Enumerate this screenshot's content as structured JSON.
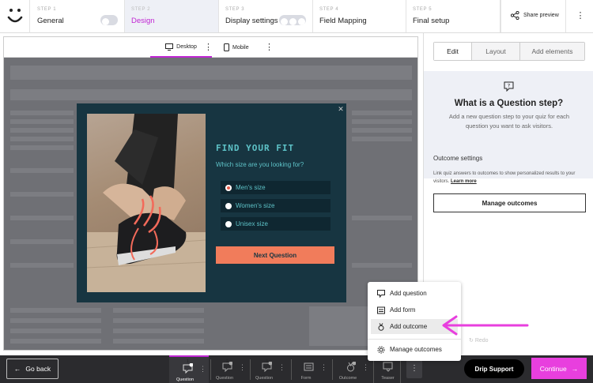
{
  "topbar": {
    "steps": [
      {
        "step_label": "STEP 1",
        "name": "General"
      },
      {
        "step_label": "STEP 2",
        "name": "Design"
      },
      {
        "step_label": "STEP 3",
        "name": "Display settings"
      },
      {
        "step_label": "STEP 4",
        "name": "Field Mapping"
      },
      {
        "step_label": "STEP 5",
        "name": "Final setup"
      }
    ],
    "share_preview": "Share preview"
  },
  "device_bar": {
    "desktop": "Desktop",
    "mobile": "Mobile"
  },
  "popup": {
    "title": "FIND YOUR FIT",
    "subtitle": "Which size are you looking for?",
    "options": [
      "Men's size",
      "Women's size",
      "Unisex size"
    ],
    "selected_option": "Men's size",
    "cta": "Next Question"
  },
  "panel": {
    "tabs": [
      "Edit",
      "Layout",
      "Add elements"
    ],
    "active_tab": "Edit",
    "info_title": "What is a Question step?",
    "info_desc": "Add a new question step to your quiz for each question you want to ask visitors.",
    "outcome_title": "Outcome settings",
    "outcome_desc": "Link quiz answers to outcomes to show personalized results to your visitors.",
    "learn_more": "Learn more",
    "manage_outcomes": "Manage outcomes",
    "redo": "Redo"
  },
  "context_menu": {
    "items": [
      "Add question",
      "Add form",
      "Add outcome",
      "Manage outcomes"
    ],
    "highlighted": "Add outcome"
  },
  "bottom": {
    "go_back": "Go back",
    "steps": [
      {
        "label": "Question",
        "badge": "1"
      },
      {
        "label": "Question",
        "badge": "2"
      },
      {
        "label": "Question",
        "badge": "3"
      },
      {
        "label": "Form",
        "badge": ""
      },
      {
        "label": "Outcome",
        "badge": "1"
      },
      {
        "label": "Teaser",
        "badge": ""
      }
    ],
    "drip_support": "Drip Support",
    "continue": "Continue"
  },
  "colors": {
    "accent": "#c026d3",
    "cta": "#f17c5b",
    "popup_bg": "#173541",
    "popup_text": "#5ec3c8",
    "arrow": "#e83fde"
  }
}
